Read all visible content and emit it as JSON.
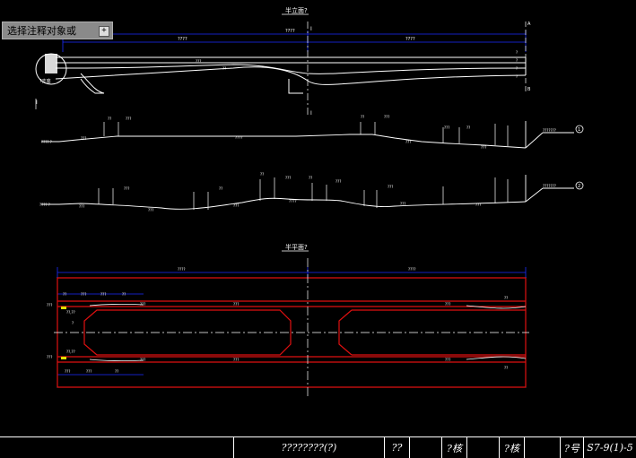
{
  "tooltip": {
    "text": "选择注释对象或",
    "expand_icon": "plus-icon"
  },
  "drawing": {
    "elevation_title": "半立面?",
    "plan_title": "半平面?",
    "section_marks": [
      "I",
      "I"
    ],
    "axis_labels": [
      "A",
      "B"
    ],
    "profile_markers": [
      "1",
      "2"
    ]
  },
  "title_block": {
    "drawing_name": "????????(?)",
    "cell_1": "??",
    "cell_2": "?核",
    "cell_3": "?核",
    "cell_4": "?号",
    "drawing_number": "S7-9(1)-5"
  },
  "colors": {
    "background": "#000000",
    "line": "#ffffff",
    "dimension": "#1c2cff",
    "structure": "#e01010",
    "annotation": "#e0e000"
  }
}
